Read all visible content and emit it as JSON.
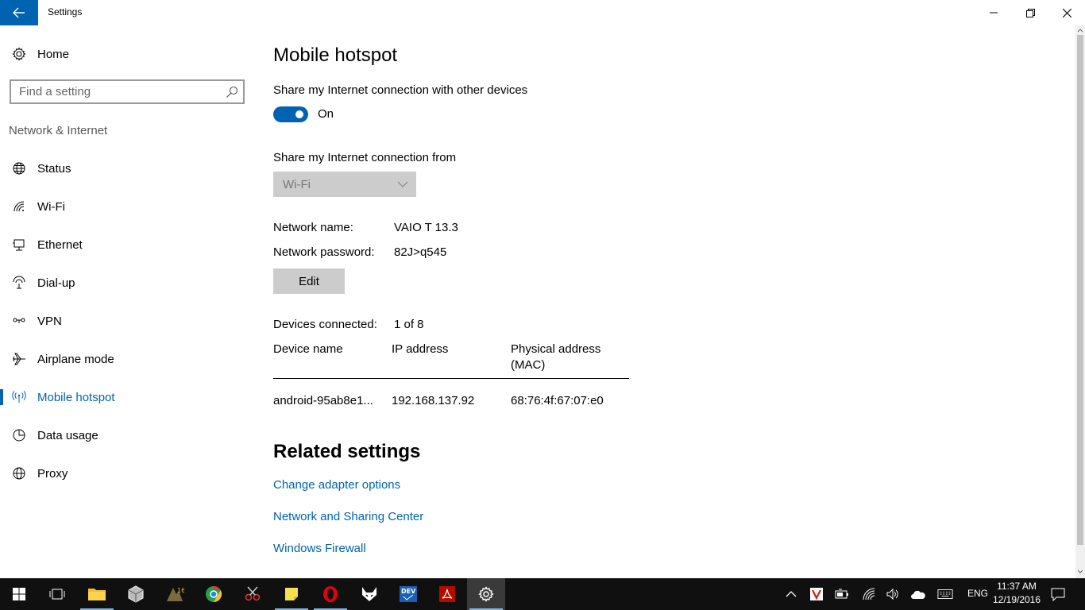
{
  "window": {
    "title": "Settings",
    "accent_color": "#0063b1"
  },
  "sidebar": {
    "home_label": "Home",
    "search_placeholder": "Find a setting",
    "section_label": "Network & Internet",
    "items": [
      {
        "label": "Status",
        "icon": "globe-icon"
      },
      {
        "label": "Wi-Fi",
        "icon": "wifi-icon"
      },
      {
        "label": "Ethernet",
        "icon": "ethernet-icon"
      },
      {
        "label": "Dial-up",
        "icon": "dialup-icon"
      },
      {
        "label": "VPN",
        "icon": "vpn-icon"
      },
      {
        "label": "Airplane mode",
        "icon": "airplane-icon"
      },
      {
        "label": "Mobile hotspot",
        "icon": "hotspot-icon",
        "active": true
      },
      {
        "label": "Data usage",
        "icon": "data-usage-icon"
      },
      {
        "label": "Proxy",
        "icon": "globe-icon"
      }
    ]
  },
  "main": {
    "title": "Mobile hotspot",
    "share_label": "Share my Internet connection with other devices",
    "toggle_state": "On",
    "share_from_label": "Share my Internet connection from",
    "share_from_value": "Wi-Fi",
    "network_name_label": "Network name:",
    "network_name_value": "VAIO T 13.3",
    "network_password_label": "Network password:",
    "network_password_value": "82J>q545",
    "edit_label": "Edit",
    "devices_connected_label": "Devices connected:",
    "devices_connected_value": "1 of 8",
    "table": {
      "headers": [
        "Device name",
        "IP address",
        "Physical address (MAC)"
      ],
      "rows": [
        [
          "android-95ab8e1...",
          "192.168.137.92",
          "68:76:4f:67:07:e0"
        ]
      ]
    },
    "related_title": "Related settings",
    "links": [
      "Change adapter options",
      "Network and Sharing Center",
      "Windows Firewall"
    ]
  },
  "taskbar": {
    "language": "ENG",
    "time": "11:37 AM",
    "date": "12/19/2016"
  }
}
